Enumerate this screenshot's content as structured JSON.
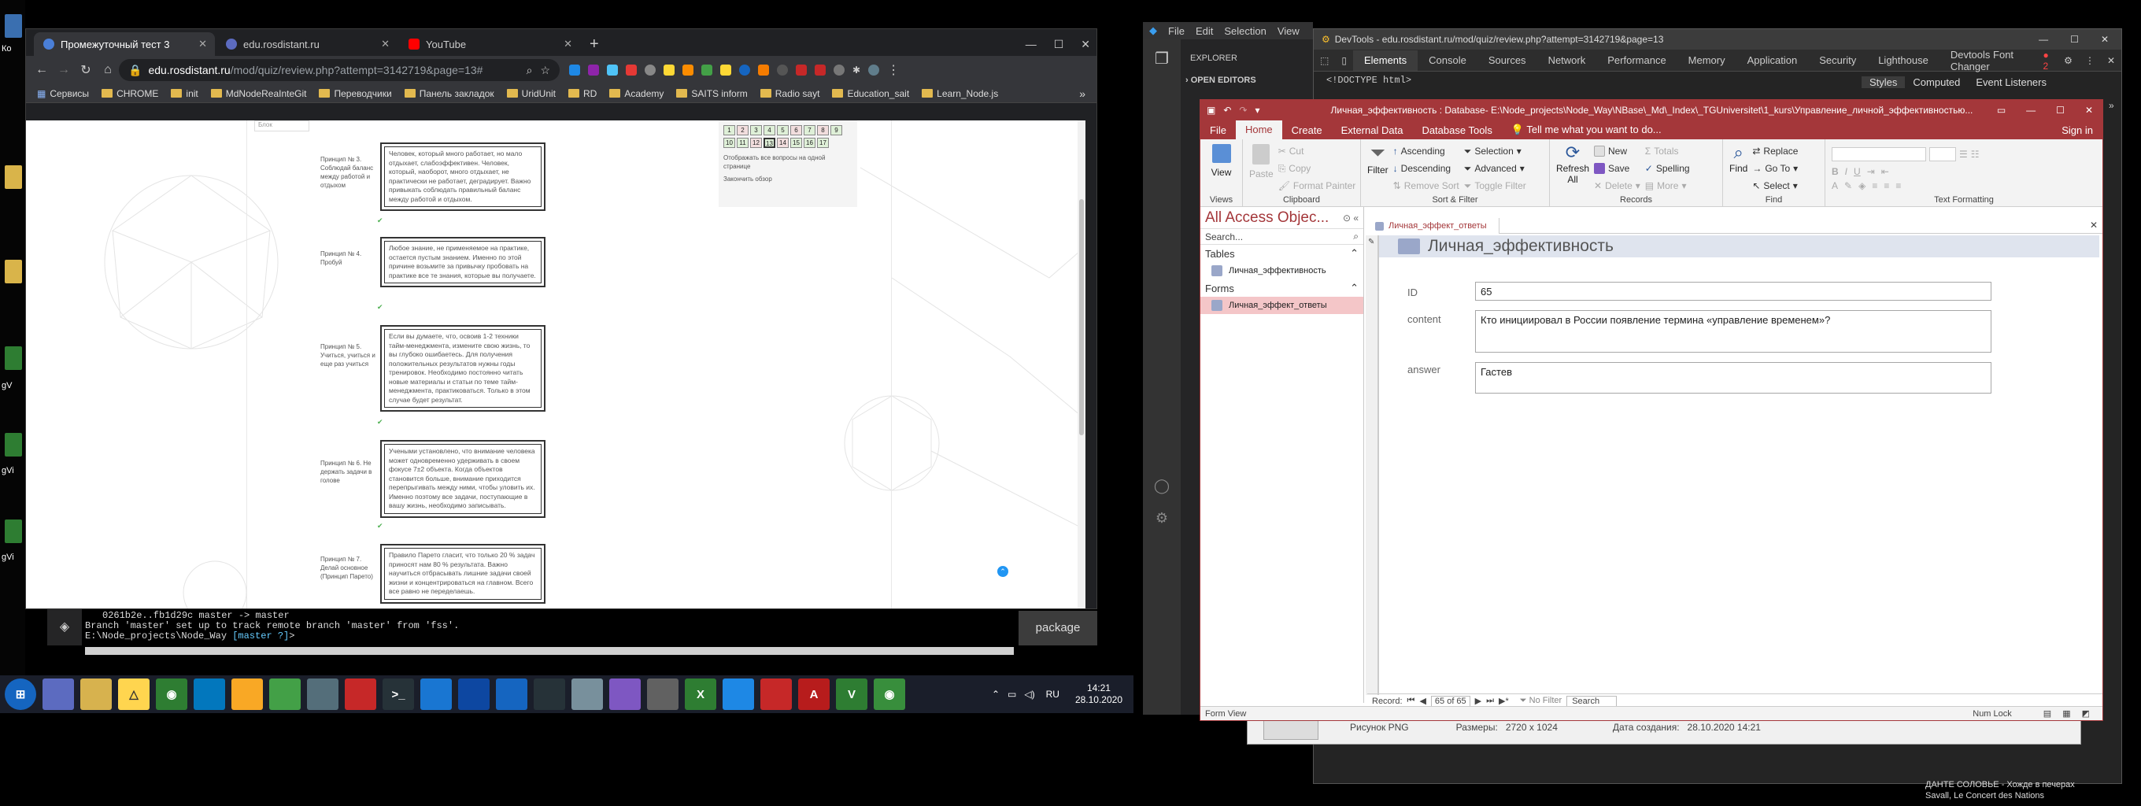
{
  "desktop": {
    "left_labels": [
      "Ко",
      "gV",
      "gVi",
      "gVi"
    ],
    "bottom_right_line1": "ДАНТЕ СОЛОВЬЕ - Хожде в печерах",
    "bottom_right_line2": "Savall, Le Concert des Nations"
  },
  "chrome": {
    "tabs": [
      {
        "label": "Промежуточный тест 3",
        "color": "#4a7fd8"
      },
      {
        "label": "edu.rosdistant.ru",
        "color": "#5c6bc0"
      },
      {
        "label": "YouTube",
        "color": "#ff0000"
      }
    ],
    "new_tab": "+",
    "url_host": "edu.rosdistant.ru",
    "url_path": "/mod/quiz/review.php?attempt=3142719&page=13#",
    "bookmarks": [
      "Сервисы",
      "CHROME",
      "init",
      "MdNodeReaInteGit",
      "Переводчики",
      "Панель закладок",
      "UridUnit",
      "RD",
      "Academy",
      "SAITS inform",
      "Radio sayt",
      "Education_sait",
      "Learn_Node.js"
    ],
    "bookmarks_more": "»",
    "page": {
      "items": [
        {
          "label": "Принцип № 3. Соблюдай баланс между работой и отдыхом",
          "text": "Человек, который много работает, но мало отдыхает, слабоэффективен. Человек, который, наоборот, много отдыхает, не практически не работает, деградирует. Важно привыкать соблюдать правильный баланс между работой и отдыхом."
        },
        {
          "label": "Принцип № 4. Пробуй",
          "text": "Любое знание, не применяемое на практике, остается пустым знанием. Именно по этой причине возьмите за привычку пробовать на практике все те знания, которые вы получаете."
        },
        {
          "label": "Принцип № 5. Учиться, учиться и еще раз учиться",
          "text": "Если вы думаете, что, освоив 1-2 техники тайм-менеджмента, измените свою жизнь, то вы глубоко ошибаетесь. Для получения положительных результатов нужны годы тренировок. Необходимо постоянно читать новые материалы и статьи по теме тайм-менеджмента, практиковаться. Только в этом случае будет результат."
        },
        {
          "label": "Принцип № 6. Не держать задачи в голове",
          "text": "Учеными установлено, что внимание человека может одновременно удерживать в своем фокусе 7±2 объекта. Когда объектов становится больше, внимание приходится перепрыгивать между ними, чтобы уловить их. Именно поэтому все задачи, поступающие в вашу жизнь, необходимо записывать."
        },
        {
          "label": "Принцип № 7. Делай основное (Принцип Парето)",
          "text": "Правило Парето гласит, что только 20 % задач приносят нам 80 % результата. Важно научиться отбрасывать лишние задачи своей жизни и концентрироваться на главном. Всего все равно не переделаешь."
        }
      ],
      "nav_numbers": [
        "1",
        "2",
        "3",
        "4",
        "5",
        "6",
        "7",
        "8",
        "9",
        "10",
        "11",
        "12",
        "13",
        "14",
        "15",
        "16",
        "17"
      ],
      "nav_show_all": "Отображать все вопросы на одной странице",
      "nav_finish": "Закончить обзор",
      "small_box": "Блок"
    }
  },
  "terminal": {
    "line1": "0261b2e..fb1d29c  master -> master",
    "line2": "Branch 'master' set up to track remote branch 'master' from 'fss'.",
    "line3_path": "E:\\Node_projects\\Node_Way",
    "line3_branch": "[master ?]",
    "line3_prompt": ">",
    "package_label": "package"
  },
  "taskbar": {
    "lang": "RU",
    "time": "14:21",
    "date": "28.10.2020"
  },
  "vscode": {
    "menu": [
      "File",
      "Edit",
      "Selection",
      "View"
    ],
    "explorer": "EXPLORER",
    "open_editors": "OPEN EDITORS"
  },
  "devtools": {
    "title": "DevTools - edu.rosdistant.ru/mod/quiz/review.php?attempt=3142719&page=13",
    "tabs": [
      "Elements",
      "Console",
      "Sources",
      "Network",
      "Performance",
      "Memory",
      "Application",
      "Security",
      "Lighthouse",
      "Devtools Font Changer"
    ],
    "badge": "2",
    "doctype": "<!DOCTYPE html>",
    "side_tabs": [
      "Styles",
      "Computed",
      "Event Listeners"
    ],
    "footer_type": "Рисунок PNG",
    "footer_size_label": "Размеры:",
    "footer_size": "2720 x 1024",
    "footer_date_label": "Дата создания:",
    "footer_date": "28.10.2020 14:21"
  },
  "access": {
    "title": "Личная_эффективность : Database- E:\\Node_projects\\Node_Way\\NBase\\_Md\\_Index\\_TGUniversitet\\1_kurs\\Управление_личной_эффективностью...",
    "signin": "Sign in",
    "ribbon_tabs": [
      "File",
      "Home",
      "Create",
      "External Data",
      "Database Tools"
    ],
    "tell_me": "Tell me what you want to do...",
    "groups": {
      "views": {
        "label": "Views",
        "view": "View"
      },
      "clipboard": {
        "label": "Clipboard",
        "paste": "Paste",
        "cut": "Cut",
        "copy": "Copy",
        "format_painter": "Format Painter"
      },
      "sort": {
        "label": "Sort & Filter",
        "filter": "Filter",
        "asc": "Ascending",
        "desc": "Descending",
        "remove": "Remove Sort",
        "selection": "Selection",
        "advanced": "Advanced",
        "toggle": "Toggle Filter"
      },
      "records": {
        "label": "Records",
        "refresh": "Refresh All",
        "new": "New",
        "save": "Save",
        "delete": "Delete",
        "totals": "Totals",
        "spelling": "Spelling",
        "more": "More"
      },
      "find": {
        "label": "Find",
        "find": "Find",
        "replace": "Replace",
        "goto": "Go To",
        "select": "Select"
      },
      "text": {
        "label": "Text Formatting"
      }
    },
    "nav": {
      "header": "All Access Objec...",
      "search": "Search...",
      "tables_label": "Tables",
      "table_item": "Личная_эффективность",
      "forms_label": "Forms",
      "form_item": "Личная_эффект_ответы"
    },
    "doc_tab": "Личная_эффект_ответы",
    "form_title": "Личная_эффективность",
    "fields": [
      {
        "label": "ID",
        "value": "65"
      },
      {
        "label": "content",
        "value": "Кто инициировал в России появление термина «управление временем»?"
      },
      {
        "label": "answer",
        "value": "Гастев"
      }
    ],
    "record_nav": {
      "label": "Record:",
      "position": "65 of 65",
      "no_filter": "No Filter",
      "search": "Search"
    },
    "status_left": "Form View",
    "status_right": "Num Lock"
  }
}
